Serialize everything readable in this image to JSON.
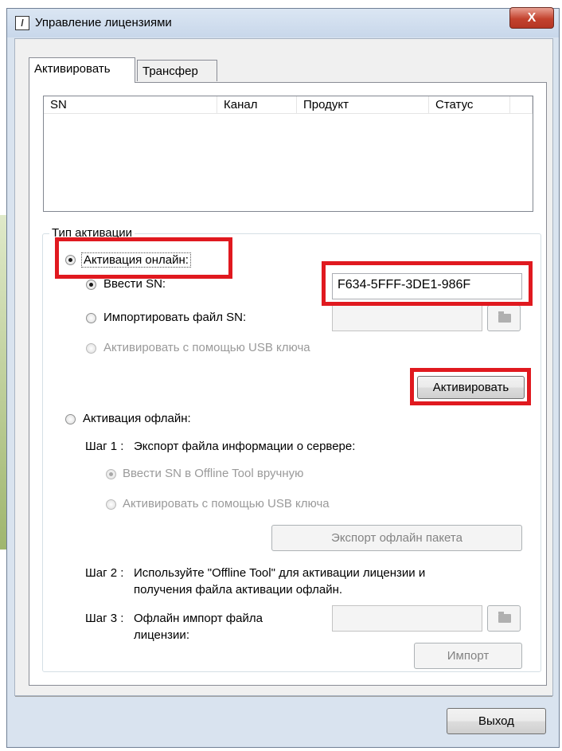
{
  "window": {
    "title": "Управление лицензиями",
    "close_glyph": "X"
  },
  "tabs": [
    {
      "label": "Активировать",
      "active": true
    },
    {
      "label": "Трансфер",
      "active": false
    }
  ],
  "table": {
    "columns": [
      "SN",
      "Канал",
      "Продукт",
      "Статус"
    ],
    "rows": []
  },
  "activation": {
    "group_title": "Тип активации",
    "online": {
      "label": "Активация онлайн:",
      "selected": true,
      "enter_sn": {
        "label": "Ввести SN:",
        "selected": true,
        "value": "F634-5FFF-3DE1-986F"
      },
      "import_file": {
        "label": "Импортировать файл SN:",
        "selected": false,
        "value": ""
      },
      "usb_key": {
        "label": "Активировать с помощью USB ключа",
        "selected": false,
        "enabled": false
      },
      "activate_button": "Активировать"
    },
    "offline": {
      "label": "Активация офлайн:",
      "selected": false,
      "step1_prefix": "Шаг 1 :",
      "step1_text": "Экспорт файла информации о сервере:",
      "enter_sn_offline": "Ввести SN в Offline Tool вручную",
      "usb_key": "Активировать с помощью USB ключа",
      "export_button": "Экспорт офлайн пакета",
      "step2_prefix": "Шаг 2 :",
      "step2_text_line1": "Используйте \"Offline Tool\" для активации лицензии и",
      "step2_text_line2": "получения файла активации офлайн.",
      "step3_prefix": "Шаг 3 :",
      "step3_text_line1": "Офлайн импорт файла",
      "step3_text_line2": "лицензии:",
      "import_button": "Импорт"
    }
  },
  "footer": {
    "exit_button": "Выход"
  },
  "colors": {
    "highlight": "#e0191f",
    "title_bar": "#c8d7ea",
    "close_button": "#c3422e"
  },
  "icons": {
    "app": "app-logo-icon",
    "close": "close-icon",
    "browse": "folder-icon"
  }
}
